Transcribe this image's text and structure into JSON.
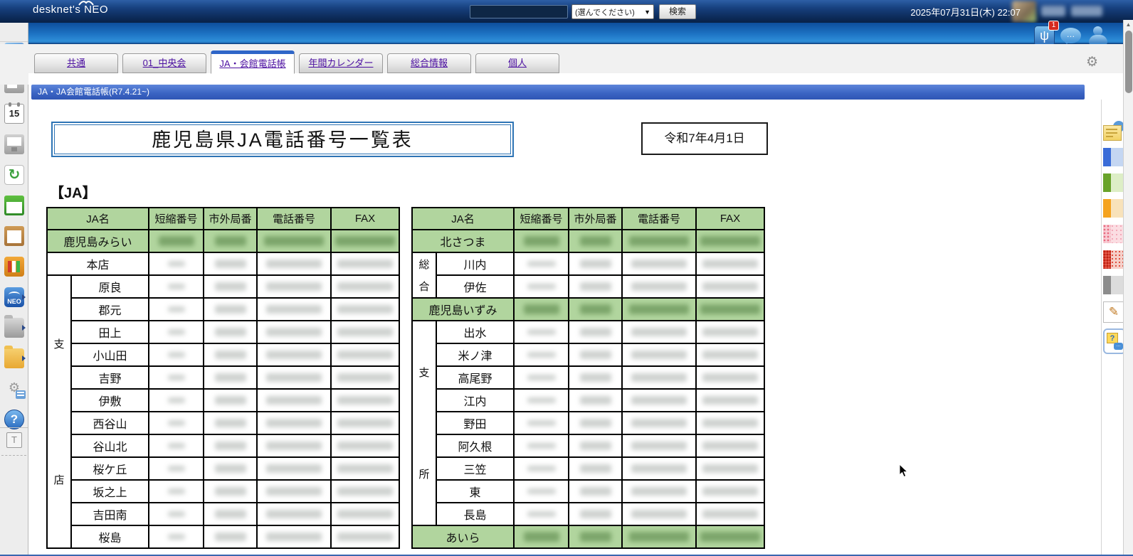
{
  "header": {
    "logo": "desknet's NEO",
    "search": {
      "value": "",
      "category": "(選んでください)",
      "button": "検索"
    },
    "datetime": "2025年07月31日(木) 22:07",
    "icons": [
      {
        "name": "infocast-icon",
        "glyph": "ψ",
        "badge": "1"
      },
      {
        "name": "chat-icon",
        "glyph": "●●●"
      },
      {
        "name": "user-icon"
      }
    ]
  },
  "tabs": [
    {
      "label": "共通",
      "active": false
    },
    {
      "label": "01_中央会",
      "active": false
    },
    {
      "label": "JA・会館電話帳",
      "active": true
    },
    {
      "label": "年間カレンダー",
      "active": false
    },
    {
      "label": "総合情報",
      "active": false
    },
    {
      "label": "個人",
      "active": false
    }
  ],
  "banner": "JA・JA会館電話帳(R7.4.21~)",
  "page": {
    "title": "鹿児島県JA電話番号一覧表",
    "date": "令和7年4月1日",
    "section_label": "【JA】"
  },
  "table_columns": [
    "JA名",
    "短縮番号",
    "市外局番",
    "電話番号",
    "FAX"
  ],
  "left_table": {
    "rows": [
      {
        "kind": "org",
        "name": "鹿児島みらい"
      },
      {
        "kind": "main",
        "name": "本店"
      },
      {
        "kind": "branch",
        "group": "支店",
        "group_span": 12,
        "name": "原良"
      },
      {
        "kind": "branch",
        "name": "郡元"
      },
      {
        "kind": "branch",
        "name": "田上"
      },
      {
        "kind": "branch",
        "name": "小山田"
      },
      {
        "kind": "branch",
        "name": "吉野"
      },
      {
        "kind": "branch",
        "name": "伊敷"
      },
      {
        "kind": "branch",
        "name": "西谷山"
      },
      {
        "kind": "branch",
        "name": "谷山北"
      },
      {
        "kind": "branch",
        "name": "桜ケ丘"
      },
      {
        "kind": "branch",
        "name": "坂之上"
      },
      {
        "kind": "branch",
        "name": "吉田南"
      },
      {
        "kind": "branch",
        "name": "桜島"
      }
    ],
    "short_smudge_width": 24
  },
  "right_table": {
    "rows": [
      {
        "kind": "org",
        "name": "北さつま"
      },
      {
        "kind": "branch",
        "group": "総合",
        "group_span": 2,
        "name": "川内"
      },
      {
        "kind": "branch",
        "name": "伊佐"
      },
      {
        "kind": "org",
        "name": "鹿児島いずみ"
      },
      {
        "kind": "branch",
        "group": "支所",
        "group_span": 9,
        "name": "出水"
      },
      {
        "kind": "branch",
        "name": "米ノ津"
      },
      {
        "kind": "branch",
        "name": "高尾野"
      },
      {
        "kind": "branch",
        "name": "江内"
      },
      {
        "kind": "branch",
        "name": "野田"
      },
      {
        "kind": "branch",
        "name": "阿久根"
      },
      {
        "kind": "branch",
        "name": "三笠"
      },
      {
        "kind": "branch",
        "name": "東"
      },
      {
        "kind": "branch",
        "name": "長島"
      },
      {
        "kind": "org",
        "name": "あいら"
      }
    ],
    "short_smudge_width": 40
  },
  "sidebar": {
    "items": [
      {
        "name": "portal-icon"
      },
      {
        "name": "bulletin-board-icon"
      },
      {
        "name": "schedule-icon",
        "glyph": "15"
      },
      {
        "name": "presentation-icon"
      },
      {
        "name": "circulation-icon",
        "glyph": "↻"
      },
      {
        "name": "todo-list-icon"
      },
      {
        "name": "clipboard-icon"
      },
      {
        "name": "bookshelf-icon"
      },
      {
        "name": "neo-app-icon",
        "glyph": "NEO",
        "arrow": true
      },
      {
        "name": "cabinet-folder-icon",
        "arrow": true
      },
      {
        "name": "shared-folder-icon",
        "arrow": true
      },
      {
        "name": "gear-memo-icon",
        "glyph": "⚙"
      },
      {
        "name": "help-icon",
        "glyph": "?"
      }
    ],
    "tool_item": {
      "name": "text-tool-icon",
      "glyph": "T"
    }
  },
  "palette": {
    "items": [
      {
        "name": "memo-icon"
      },
      {
        "name": "color-swatch-blue"
      },
      {
        "name": "color-swatch-green"
      },
      {
        "name": "color-swatch-orange"
      },
      {
        "name": "color-swatch-pink"
      },
      {
        "name": "color-swatch-red"
      },
      {
        "name": "color-swatch-gray"
      },
      {
        "name": "pencil-icon",
        "glyph": "✎"
      },
      {
        "name": "help-chat-icon",
        "glyph": "?"
      }
    ]
  },
  "colors": {
    "table_green": "#b1d59e",
    "banner_blue": "#3a63c2",
    "title_border_blue": "#2e74b5",
    "active_tab_blue": "#2f66c8",
    "badge_red": "#d52a1e"
  }
}
